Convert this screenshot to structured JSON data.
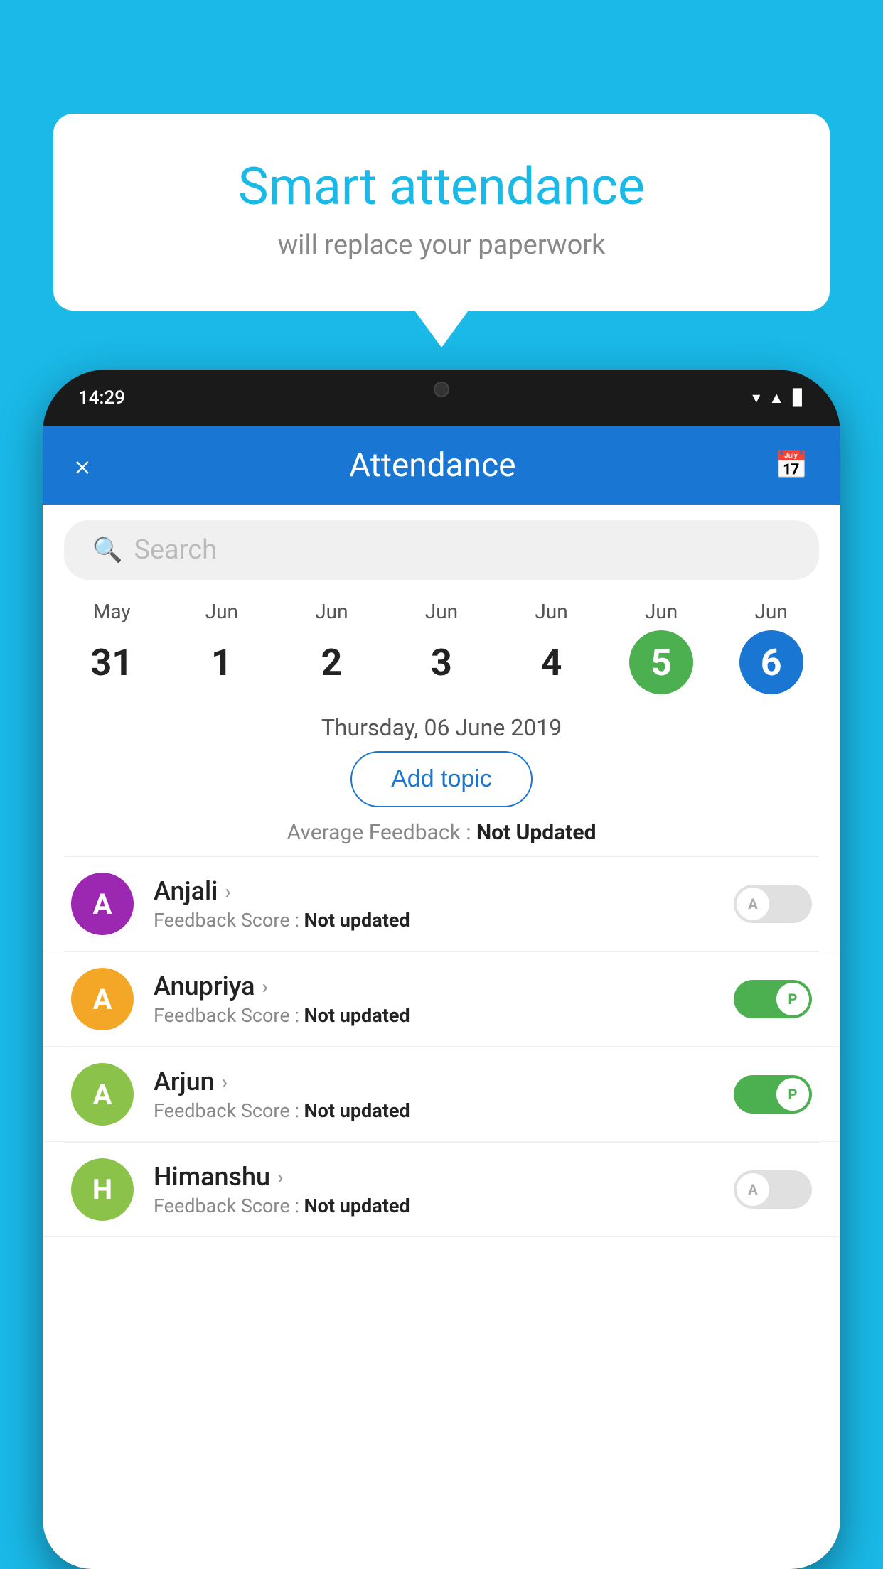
{
  "background_color": "#1ab9e8",
  "bubble": {
    "title": "Smart attendance",
    "subtitle": "will replace your paperwork"
  },
  "phone": {
    "status_time": "14:29",
    "header": {
      "title": "Attendance",
      "close_label": "×",
      "calendar_icon": "📅"
    },
    "search": {
      "placeholder": "Search"
    },
    "calendar": [
      {
        "month": "May",
        "date": "31",
        "state": "normal"
      },
      {
        "month": "Jun",
        "date": "1",
        "state": "normal"
      },
      {
        "month": "Jun",
        "date": "2",
        "state": "normal"
      },
      {
        "month": "Jun",
        "date": "3",
        "state": "normal"
      },
      {
        "month": "Jun",
        "date": "4",
        "state": "normal"
      },
      {
        "month": "Jun",
        "date": "5",
        "state": "today"
      },
      {
        "month": "Jun",
        "date": "6",
        "state": "selected"
      }
    ],
    "selected_date": "Thursday, 06 June 2019",
    "add_topic_label": "Add topic",
    "avg_feedback_label": "Average Feedback : ",
    "avg_feedback_value": "Not Updated",
    "students": [
      {
        "name": "Anjali",
        "avatar_letter": "A",
        "avatar_color": "#9c27b0",
        "feedback": "Feedback Score : ",
        "feedback_value": "Not updated",
        "attendance": "absent",
        "toggle_label": "A"
      },
      {
        "name": "Anupriya",
        "avatar_letter": "A",
        "avatar_color": "#f4a726",
        "feedback": "Feedback Score : ",
        "feedback_value": "Not updated",
        "attendance": "present",
        "toggle_label": "P"
      },
      {
        "name": "Arjun",
        "avatar_letter": "A",
        "avatar_color": "#8bc34a",
        "feedback": "Feedback Score : ",
        "feedback_value": "Not updated",
        "attendance": "present",
        "toggle_label": "P"
      },
      {
        "name": "Himanshu",
        "avatar_letter": "H",
        "avatar_color": "#8bc34a",
        "feedback": "Feedback Score : ",
        "feedback_value": "Not updated",
        "attendance": "absent",
        "toggle_label": "A"
      }
    ]
  }
}
